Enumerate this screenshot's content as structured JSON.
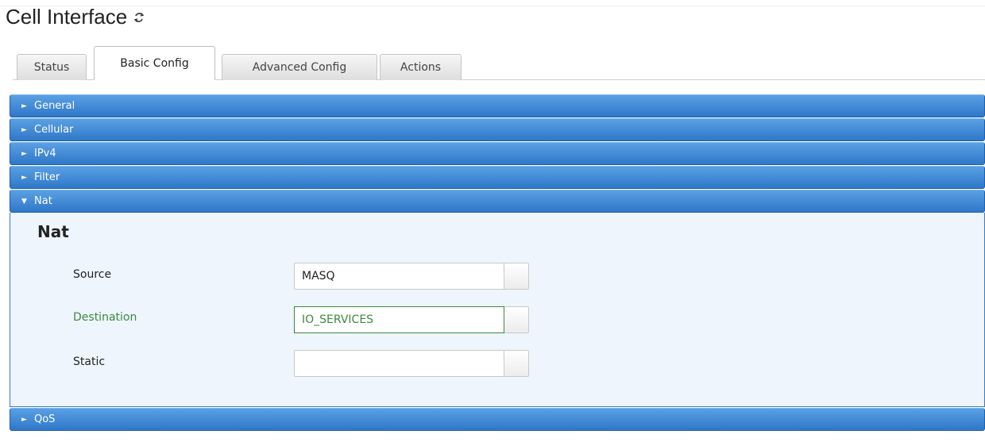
{
  "page": {
    "title": "Cell Interface"
  },
  "tabs": [
    {
      "label": "Status"
    },
    {
      "label": "Basic Config"
    },
    {
      "label": "Advanced Config"
    },
    {
      "label": "Actions"
    }
  ],
  "sections": {
    "general": "General",
    "cellular": "Cellular",
    "ipv4": "IPv4",
    "filter": "Filter",
    "nat": "Nat",
    "qos": "QoS"
  },
  "nat_panel": {
    "heading": "Nat",
    "source": {
      "label": "Source",
      "value": "MASQ"
    },
    "destination": {
      "label": "Destination",
      "value": "IO_SERVICES"
    },
    "static": {
      "label": "Static",
      "value": ""
    }
  },
  "colors": {
    "accordion_header": "#3a86d6",
    "panel_background": "#eef5fd",
    "focus_green": "#3b8a3b"
  }
}
